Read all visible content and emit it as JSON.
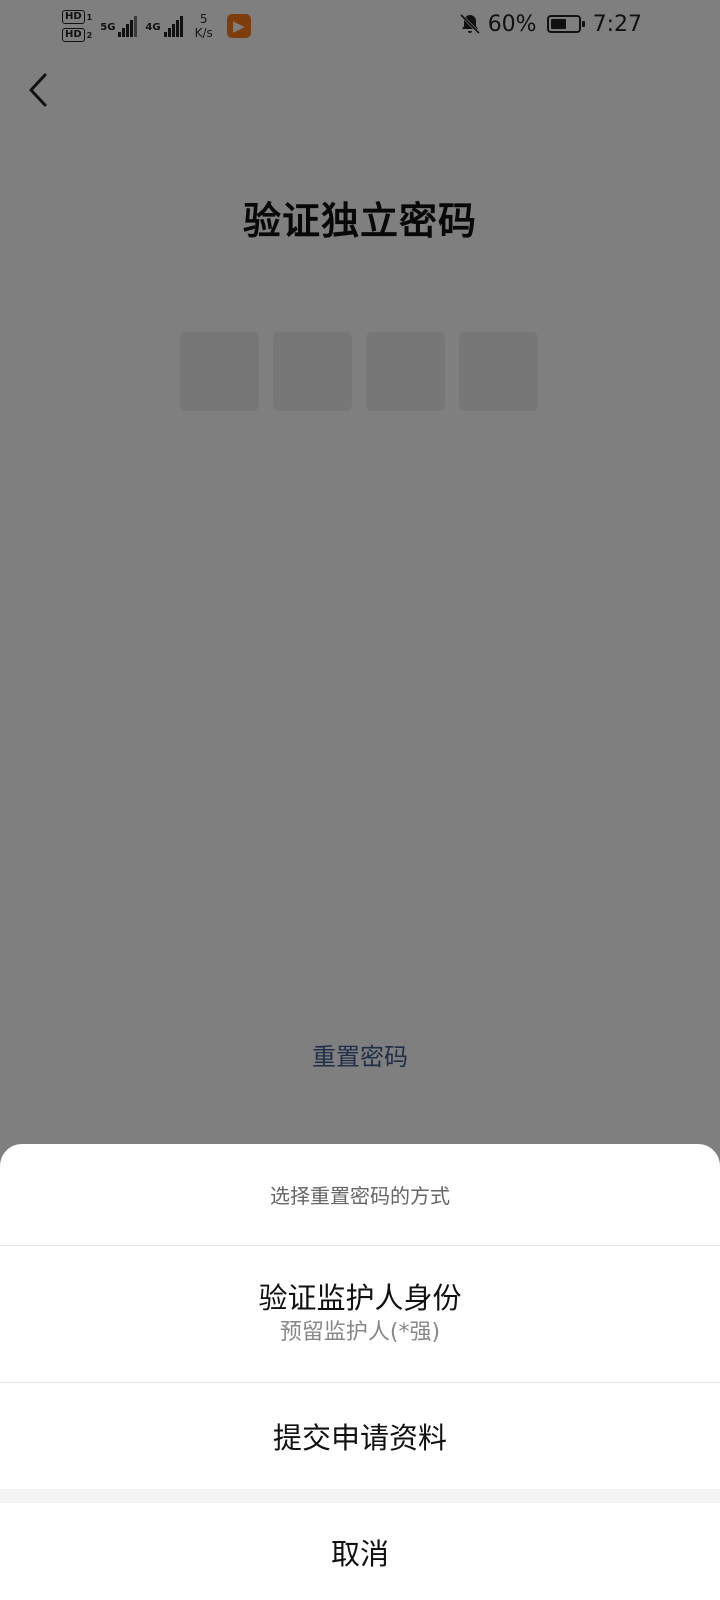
{
  "status_bar": {
    "hd1": "HD",
    "hd1_index": "1",
    "hd2": "HD",
    "hd2_index": "2",
    "net1": "5G",
    "net2": "4G",
    "speed_value": "5",
    "speed_unit": "K/s",
    "battery": "60%",
    "battery_level": 0.6,
    "time": "7:27",
    "app_icon": "video-app-icon"
  },
  "page": {
    "title": "验证独立密码",
    "pin_length": 4,
    "reset_link": "重置密码"
  },
  "sheet": {
    "title": "选择重置密码的方式",
    "option_guardian": "验证监护人身份",
    "option_guardian_sub": "预留监护人(*强)",
    "option_submit": "提交申请资料",
    "cancel": "取消"
  },
  "colors": {
    "link": "#3e5c92",
    "overlay": "rgba(0,0,0,0.5)",
    "app_icon": "#ff7a1a"
  }
}
